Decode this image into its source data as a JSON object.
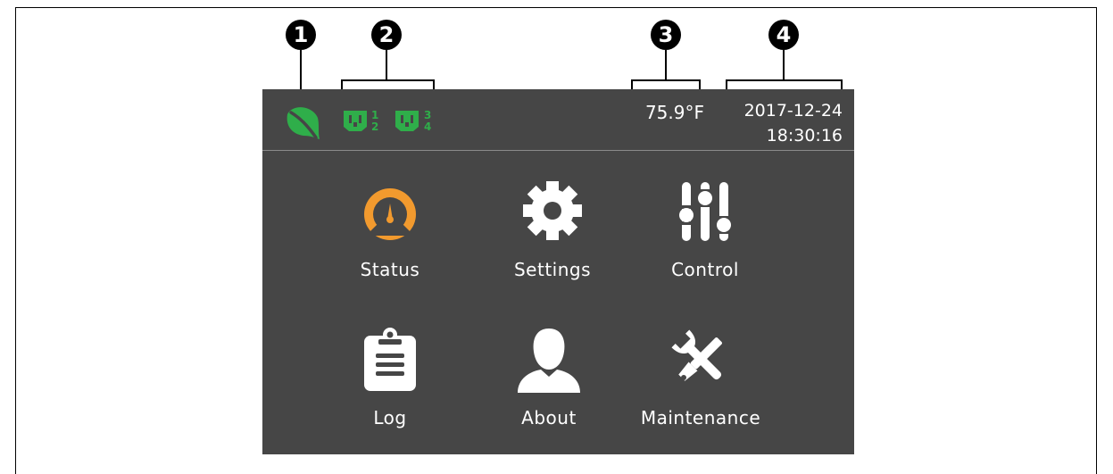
{
  "callouts": [
    "1",
    "2",
    "3",
    "4"
  ],
  "statusbar": {
    "eco_icon": "leaf-icon",
    "outlets": [
      {
        "icon": "outlet-icon",
        "top_num": "1",
        "bottom_num": "2"
      },
      {
        "icon": "outlet-icon",
        "top_num": "3",
        "bottom_num": "4"
      }
    ],
    "temperature": "75.9°F",
    "date": "2017-12-24",
    "time": "18:30:16"
  },
  "menu": {
    "items": [
      {
        "label": "Status",
        "icon": "gauge-icon"
      },
      {
        "label": "Settings",
        "icon": "gear-icon"
      },
      {
        "label": "Control",
        "icon": "sliders-icon"
      },
      {
        "label": "Log",
        "icon": "clipboard-icon"
      },
      {
        "label": "About",
        "icon": "user-icon"
      },
      {
        "label": "Maintenance",
        "icon": "tools-icon"
      }
    ]
  },
  "colors": {
    "screen_bg": "#464646",
    "accent_green": "#2fae4a",
    "accent_orange": "#f29a2e",
    "text": "#ffffff"
  }
}
